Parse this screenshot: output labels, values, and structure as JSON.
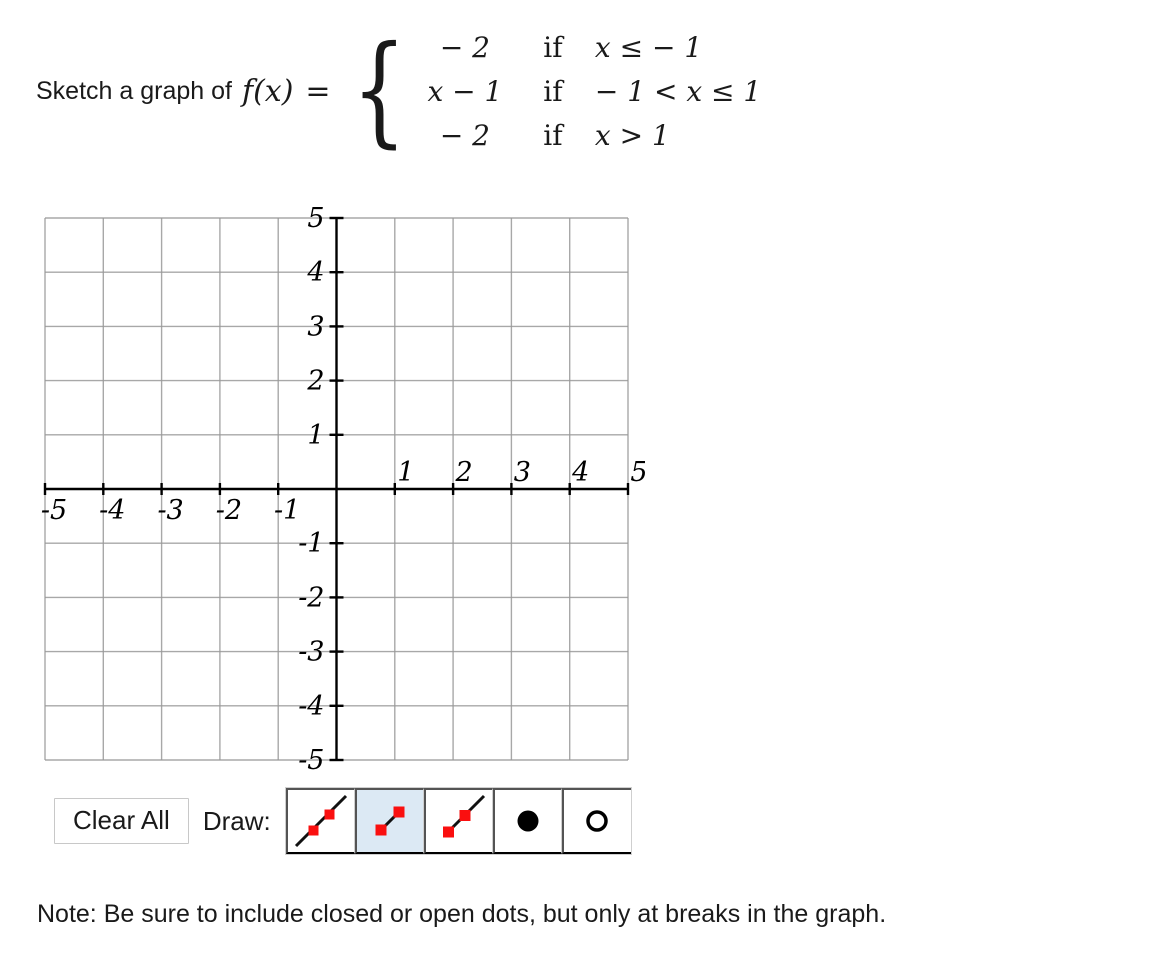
{
  "prompt": {
    "text": "Sketch a graph of",
    "function_label": "f(x)",
    "equals": "=",
    "brace": "{",
    "cases": [
      {
        "value": "− 2",
        "if": "if",
        "condition": "x ≤ − 1"
      },
      {
        "value": "x − 1",
        "if": "if",
        "condition": "− 1 < x ≤ 1"
      },
      {
        "value": "− 2",
        "if": "if",
        "condition": "x > 1"
      }
    ]
  },
  "graph": {
    "x_axis_labels": [
      "-5",
      "-4",
      "-3",
      "-2",
      "-1",
      "1",
      "2",
      "3",
      "4",
      "5"
    ],
    "y_axis_labels": [
      "5",
      "4",
      "3",
      "2",
      "1",
      "-1",
      "-2",
      "-3",
      "-4",
      "-5"
    ],
    "xlim": [
      -5,
      5
    ],
    "ylim": [
      -5,
      5
    ],
    "tick_step": 1,
    "grid": true,
    "grid_color": "#999999",
    "axis_color": "#000000",
    "plotted_curves": []
  },
  "toolbar": {
    "clear_all_label": "Clear All",
    "draw_label": "Draw:",
    "selected_tool_index": 1,
    "tools": [
      {
        "name": "line-tool",
        "title": "Line"
      },
      {
        "name": "segment-tool",
        "title": "Line Segment"
      },
      {
        "name": "ray-tool",
        "title": "Ray"
      },
      {
        "name": "closed-dot-tool",
        "title": "Closed Dot"
      },
      {
        "name": "open-dot-tool",
        "title": "Open Dot"
      }
    ],
    "marker_color": "#fa0f0f",
    "selected_bg": "#dce9f4"
  },
  "note": {
    "text": "Note: Be sure to include closed or open dots, but only at breaks in the graph."
  }
}
